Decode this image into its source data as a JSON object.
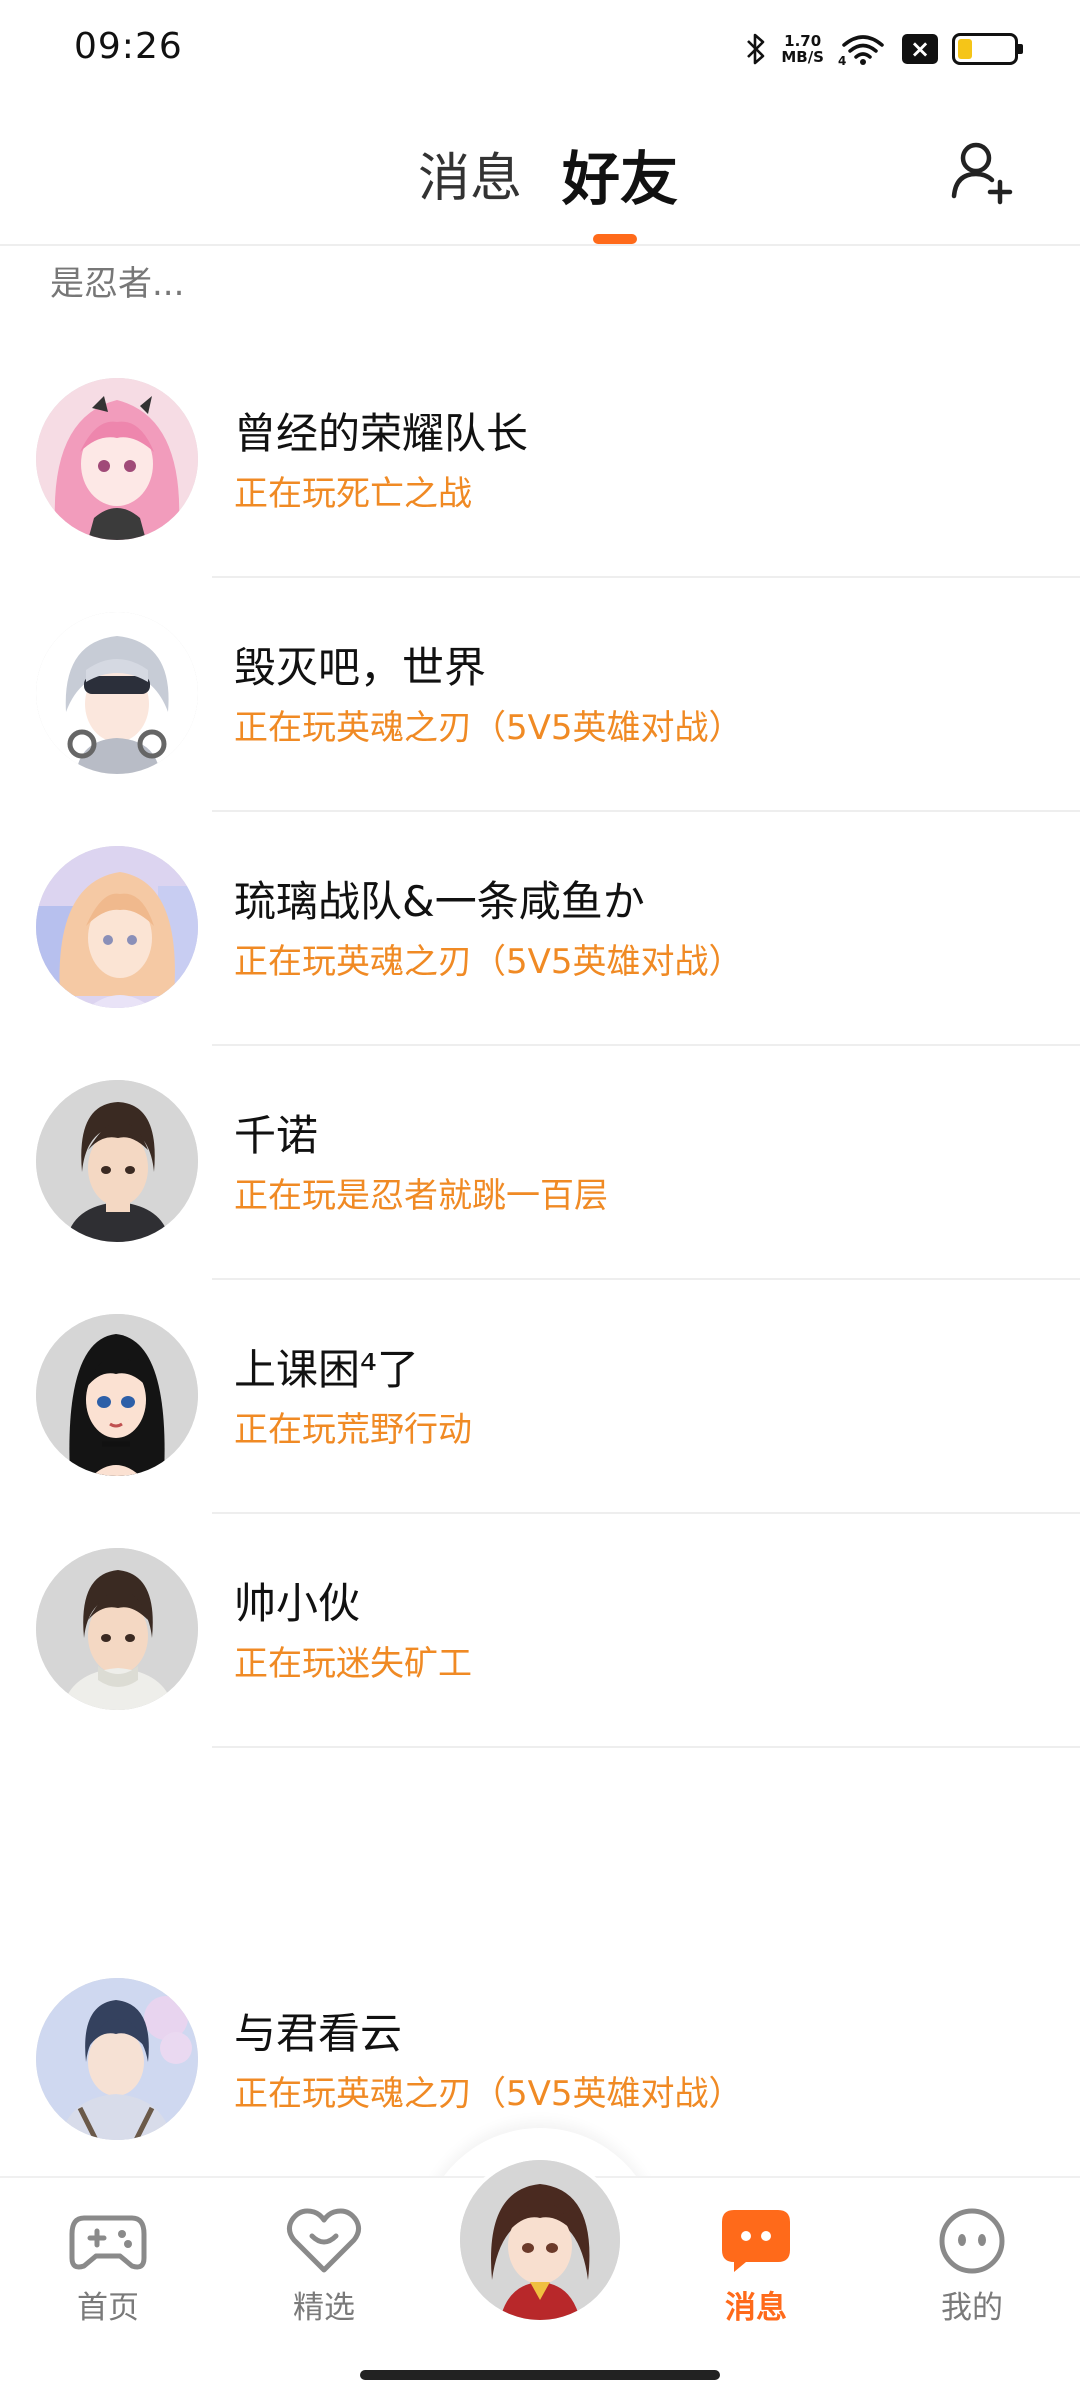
{
  "status_bar": {
    "time": "09:26",
    "net_speed_value": "1.70",
    "net_speed_unit": "MB/S",
    "signal_label": "4",
    "battery_level": 0.25
  },
  "header": {
    "tab_messages": "消息",
    "tab_friends": "好友",
    "active_tab": "好友"
  },
  "section_label": "是忍者...",
  "friends": [
    {
      "name": "曾经的荣耀队长",
      "status": "正在玩死亡之战",
      "avatar": "pink-hair-girl-avatar"
    },
    {
      "name": "毁灭吧，世界",
      "status": "正在玩英魂之刃（5V5英雄对战）",
      "avatar": "white-hair-boy-avatar"
    },
    {
      "name": "琉璃战队&一条咸鱼か",
      "status": "正在玩英魂之刃（5V5英雄对战）",
      "avatar": "blonde-girl-avatar"
    },
    {
      "name": "千诺",
      "status": "正在玩是忍者就跳一百层",
      "avatar": "dark-hair-boy-avatar"
    },
    {
      "name": "上课困⁴了",
      "status": "正在玩荒野行动",
      "avatar": "black-hair-girl-avatar"
    },
    {
      "name": "帅小伙",
      "status": "正在玩迷失矿工",
      "avatar": "sweater-boy-avatar"
    },
    {
      "name": "与君看云",
      "status": "正在玩英魂之刃（5V5英雄对战）",
      "avatar": "sky-boy-avatar"
    }
  ],
  "bottom_nav": {
    "home": "首页",
    "featured": "精选",
    "messages": "消息",
    "me": "我的",
    "active": "消息"
  },
  "colors": {
    "accent": "#ff6a1a",
    "status_text": "#f08a24"
  }
}
